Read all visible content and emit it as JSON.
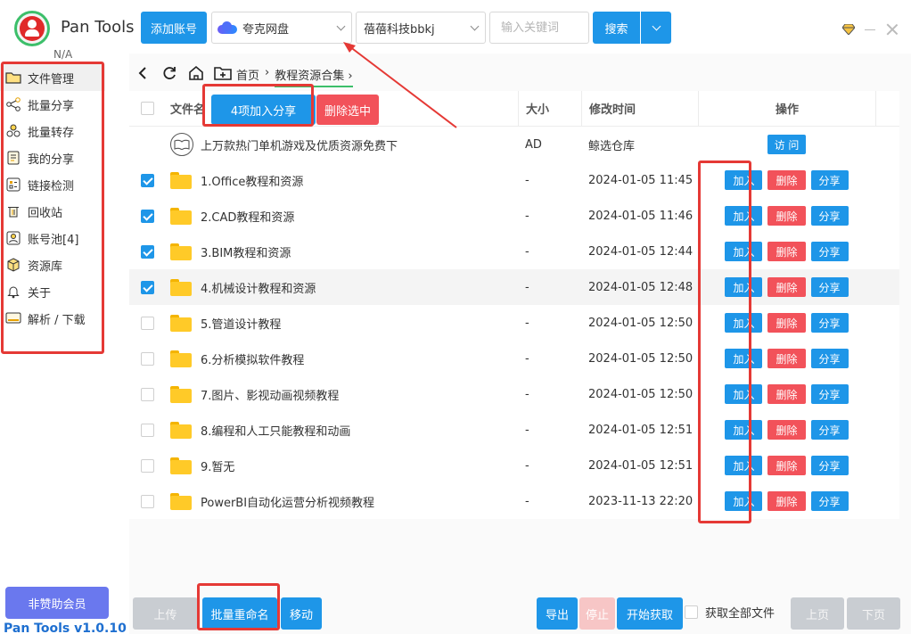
{
  "app": {
    "title": "Pan Tools",
    "user": "N/A",
    "version": "Pan Tools v1.0.10"
  },
  "toolbar": {
    "add_account": "添加账号",
    "drive": "夸克网盘",
    "account": "蓓蓓科技bbkj",
    "keyword_placeholder": "输入关键词",
    "search": "搜索"
  },
  "sidebar": {
    "items": [
      {
        "label": "文件管理",
        "icon": "folder-icon"
      },
      {
        "label": "批量分享",
        "icon": "share-icon"
      },
      {
        "label": "批量转存",
        "icon": "transfer-icon"
      },
      {
        "label": "我的分享",
        "icon": "notes-icon"
      },
      {
        "label": "链接检测",
        "icon": "checklist-icon"
      },
      {
        "label": "回收站",
        "icon": "trash-icon"
      },
      {
        "label": "账号池[4]",
        "icon": "account-icon"
      },
      {
        "label": "资源库",
        "icon": "box-icon"
      },
      {
        "label": "关于",
        "icon": "bell-icon"
      },
      {
        "label": "解析 / 下载",
        "icon": "download-icon"
      }
    ],
    "sponsor": "非赞助会员"
  },
  "breadcrumb": {
    "home": "首页",
    "current": "教程资源合集"
  },
  "table": {
    "headers": {
      "name": "文件名",
      "size": "大小",
      "time": "修改时间",
      "ops": "操作"
    },
    "add_share": "4项加入分享",
    "delete_selected": "删除选中",
    "ad_row": {
      "name": "上万款热门单机游戏及优质资源免费下",
      "size": "AD",
      "time": "鲸选仓库",
      "action": "访 问"
    },
    "op_labels": {
      "add": "加入",
      "delete": "删除",
      "share": "分享"
    },
    "rows": [
      {
        "name": "1.Office教程和资源",
        "size": "-",
        "time": "2024-01-05 11:45",
        "checked": true
      },
      {
        "name": "2.CAD教程和资源",
        "size": "-",
        "time": "2024-01-05 11:46",
        "checked": true
      },
      {
        "name": "3.BIM教程和资源",
        "size": "-",
        "time": "2024-01-05 12:44",
        "checked": true
      },
      {
        "name": "4.机械设计教程和资源",
        "size": "-",
        "time": "2024-01-05 12:48",
        "checked": true
      },
      {
        "name": "5.管道设计教程",
        "size": "-",
        "time": "2024-01-05 12:50",
        "checked": false
      },
      {
        "name": "6.分析模拟软件教程",
        "size": "-",
        "time": "2024-01-05 12:50",
        "checked": false
      },
      {
        "name": "7.图片、影视动画视频教程",
        "size": "-",
        "time": "2024-01-05 12:50",
        "checked": false
      },
      {
        "name": "8.编程和人工只能教程和动画",
        "size": "-",
        "time": "2024-01-05 12:51",
        "checked": false
      },
      {
        "name": "9.暂无",
        "size": "-",
        "time": "2024-01-05 12:51",
        "checked": false
      },
      {
        "name": "PowerBI自动化运营分析视频教程",
        "size": "-",
        "time": "2023-11-13 22:20",
        "checked": false
      }
    ]
  },
  "bottom": {
    "upload": "上传",
    "batch_rename": "批量重命名",
    "move": "移动",
    "export": "导出",
    "stop": "停止",
    "start_fetch": "开始获取",
    "fetch_all": "获取全部文件",
    "prev": "上页",
    "next": "下页"
  },
  "colors": {
    "accent": "#1e96e8",
    "danger": "#f2525a",
    "annotation": "#e53935",
    "sponsor": "#6a78ee"
  }
}
